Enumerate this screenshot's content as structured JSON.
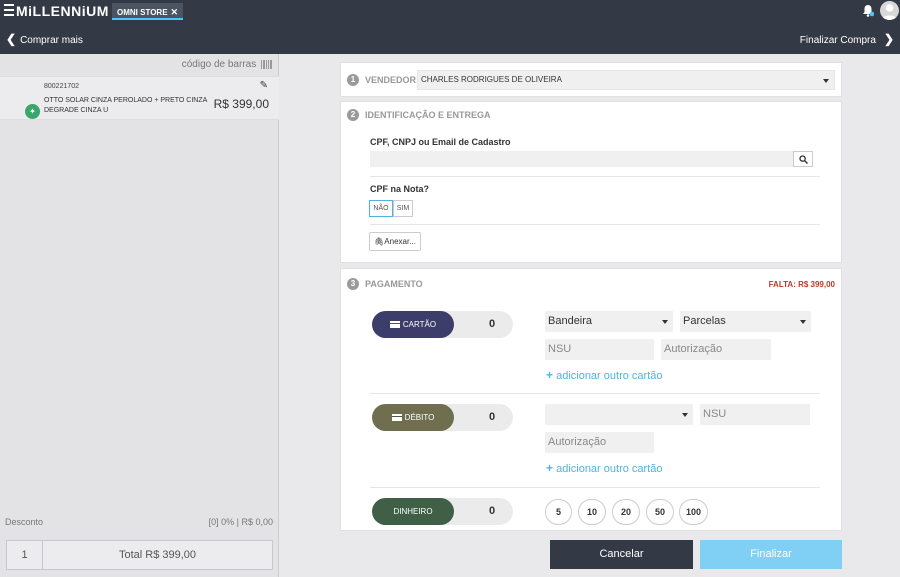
{
  "header": {
    "brand": "MiLLENNiUM",
    "store_tab": "OMNI STORE",
    "store_tab_close": "✕"
  },
  "nav": {
    "back_label": "Comprar mais",
    "finish_label": "Finalizar Compra"
  },
  "cart": {
    "barcode_label": "código de barras",
    "items": [
      {
        "code": "800221702",
        "name": "OTTO SOLAR CINZA PEROLADO + PRETO CINZA DEGRADE CINZA U",
        "price": "R$ 399,00"
      }
    ],
    "discount_label": "Desconto",
    "discount_value": "[0] 0% | R$ 0,00",
    "quantity": "1",
    "total": "Total R$ 399,00"
  },
  "sections": {
    "vendor": {
      "number": "1",
      "title": "VENDEDOR:",
      "selected": "CHARLES RODRIGUES DE OLIVEIRA"
    },
    "identification": {
      "number": "2",
      "title": "IDENTIFICAÇÃO E ENTREGA",
      "cpf_label": "CPF, CNPJ ou Email de Cadastro",
      "cpf_value": "",
      "cpf_note_label": "CPF na Nota?",
      "no_label": "NÃO",
      "yes_label": "SIM",
      "attach_label": "Anexar..."
    },
    "payment": {
      "number": "3",
      "title": "PAGAMENTO",
      "missing": "FALTA: R$ 399,00",
      "card": {
        "label": "CARTÃO",
        "amount": "0",
        "brand_placeholder": "Bandeira",
        "installments_placeholder": "Parcelas",
        "nsu_placeholder": "NSU",
        "auth_placeholder": "Autorização",
        "add_label": "adicionar outro cartão",
        "color": "#3d3d6b"
      },
      "debit": {
        "label": "DÉBITO",
        "amount": "0",
        "brand_placeholder": "",
        "nsu_placeholder": "NSU",
        "auth_placeholder": "Autorização",
        "add_label": "adicionar outro cartão",
        "color": "#6f6f4f"
      },
      "cash": {
        "label": "DINHEIRO",
        "amount": "0",
        "quick_amounts": [
          "5",
          "10",
          "20",
          "50",
          "100"
        ],
        "color": "#3f5f47"
      }
    }
  },
  "actions": {
    "cancel_label": "Cancelar",
    "finish_label": "Finalizar"
  }
}
